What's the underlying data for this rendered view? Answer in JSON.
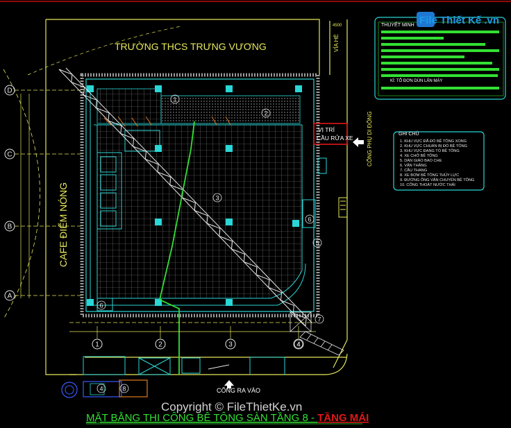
{
  "colors": {
    "background": "#000000",
    "outline": "#e6e85a",
    "structure": "#2ad6d6",
    "grid": "#9a9a9a",
    "crane": "#e8e8e8",
    "green": "#33e033",
    "red": "#e01818",
    "blue": "#3a5aff",
    "white": "#ffffff"
  },
  "labels": {
    "school": "TRƯỜNG THCS TRƯNG VƯƠNG",
    "cafe": "CAFE ĐIỂM NÓNG",
    "sidewalk": "VỈA HÈ",
    "side_gate": "CỔNG PHỤ DI ĐỘNG",
    "main_gate": "CỔNG RA VÀO",
    "wash_title_1": "VỊ TRÍ",
    "wash_title_2": "CẦU RỬA XE",
    "dim_top": "4500",
    "plan_title_a": "MẶT BẰNG THI CÔNG BÊ TÔNG SÀN TẦNG 8 - ",
    "plan_title_b": "TẦNG MÁI",
    "watermark": "Copyright © FileThietKe.vn",
    "logo_text": "File Thiết Kế .vn"
  },
  "axes": {
    "letters": [
      "D",
      "C",
      "B",
      "A"
    ],
    "numbers": [
      "1",
      "2",
      "3",
      "4"
    ]
  },
  "zone_marks": [
    "1",
    "2",
    "3",
    "4",
    "5",
    "6",
    "6",
    "7",
    "8",
    "4"
  ],
  "notes_box": {
    "title": "THUYẾT MINH",
    "visible_line": "KÍ: TỔ ĐƠN DÙN LẤN MÁY"
  },
  "legend": {
    "title": "GHI CHÚ",
    "items": [
      "1. KHU VỰC ĐÃ ĐỔ BÊ TÔNG XONG",
      "2. KHU VỰC CHUẨN BỊ ĐỔ BÊ TÔNG",
      "3. KHU VỰC ĐANG TỔ BÊ TÔNG",
      "4. XE CHỞ BÊ TÔNG",
      "5. DÀN GIÁO BAO CHE",
      "6. VẬN THĂNG",
      "7. CẦU THANG",
      "8. XE BƠM BÊ TÔNG THỦY LỰC",
      "9. ĐƯỜNG ỐNG VẬN CHUYỂN BÊ TÔNG",
      "10. CỐNG THOÁT NƯỚC THẢI"
    ]
  }
}
